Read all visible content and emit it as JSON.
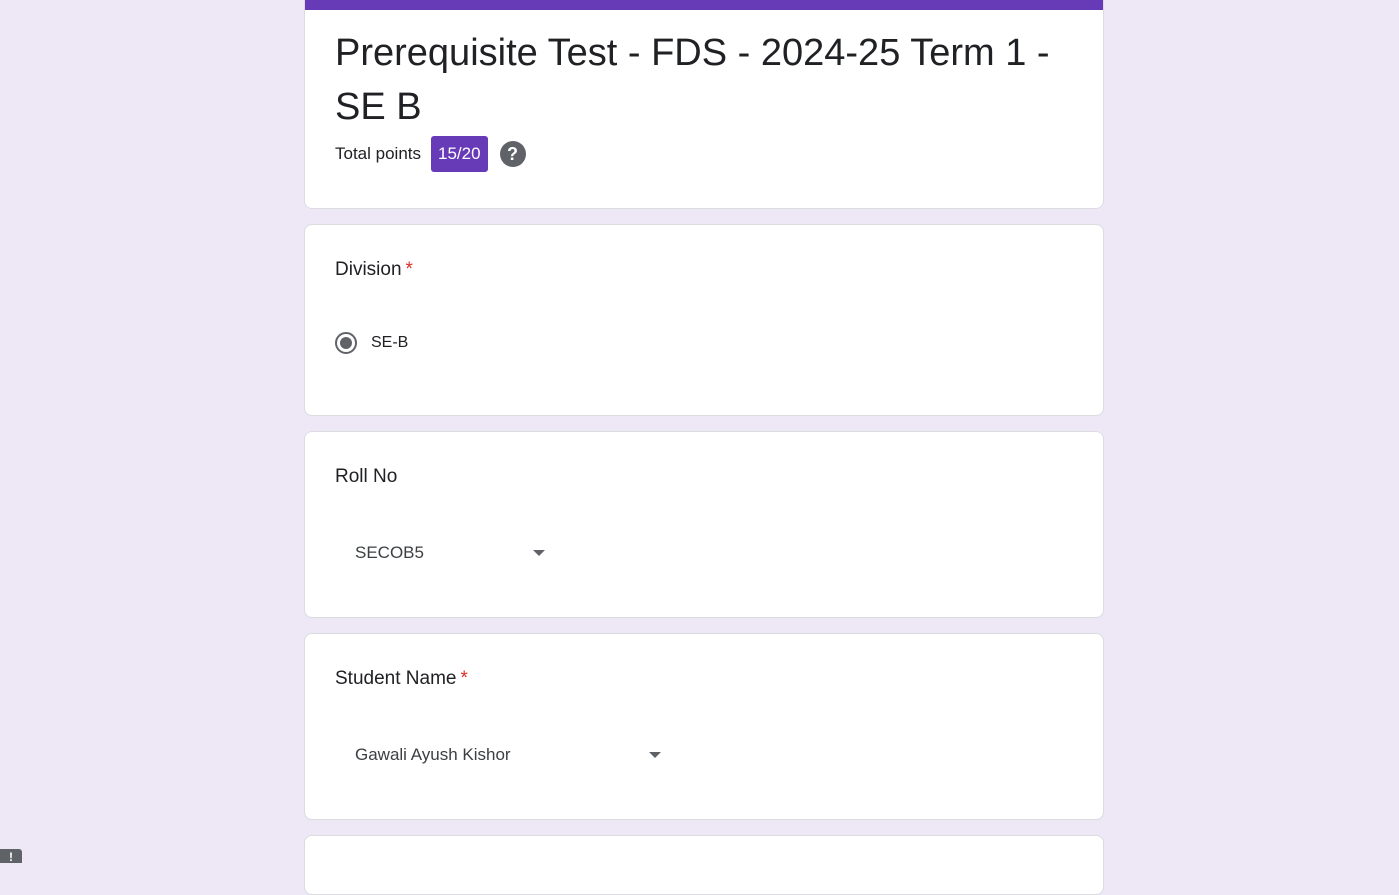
{
  "header": {
    "title": "Prerequisite Test - FDS - 2024-25  Term 1 - SE B",
    "points_label": "Total points",
    "points_value": "15/20",
    "help_icon": "help-icon",
    "accent_color": "#673ab7"
  },
  "questions": [
    {
      "title": "Division",
      "required": true,
      "required_mark": "*",
      "type": "radio",
      "selected_option": "SE-B"
    },
    {
      "title": "Roll No",
      "required": false,
      "type": "dropdown",
      "selected_value": "SECOB5",
      "icon": "chevron-down-icon"
    },
    {
      "title": "Student Name",
      "required": true,
      "required_mark": "*",
      "type": "dropdown",
      "selected_value": "Gawali Ayush Kishor",
      "icon": "chevron-down-icon"
    }
  ],
  "colors": {
    "background": "#ede7f6",
    "required": "#d93025"
  }
}
